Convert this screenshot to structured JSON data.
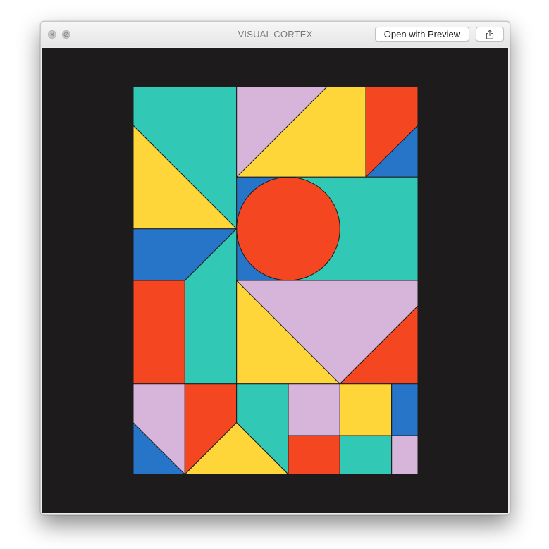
{
  "window": {
    "title": "VISUAL CORTEX",
    "open_with_preview_label": "Open with Preview"
  },
  "icons": {
    "close": "close-icon",
    "minimize": "minimize-icon",
    "share": "share-icon"
  },
  "colors": {
    "teal": "#31c9b5",
    "lilac": "#d7b5da",
    "yellow": "#fed63a",
    "red": "#f34621",
    "blue": "#2775c9",
    "background": "#1d1b1b"
  }
}
